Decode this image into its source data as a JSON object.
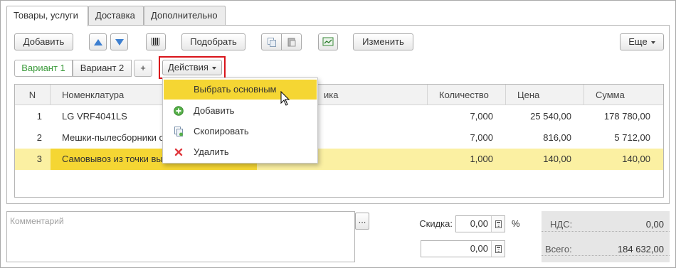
{
  "tabs": [
    {
      "label": "Товары, услуги",
      "active": true
    },
    {
      "label": "Доставка",
      "active": false
    },
    {
      "label": "Дополнительно",
      "active": false
    }
  ],
  "toolbar": {
    "add_label": "Добавить",
    "pick_label": "Подобрать",
    "edit_label": "Изменить",
    "more_label": "Еще"
  },
  "variants": {
    "items": [
      "Вариант 1",
      "Вариант 2"
    ],
    "add_label": "+",
    "actions_label": "Действия"
  },
  "table": {
    "columns": [
      "N",
      "Номенклатура",
      "ика",
      "Количество",
      "Цена",
      "Сумма"
    ],
    "rows": [
      {
        "n": "1",
        "name": "LG VRF4041LS",
        "qty": "7,000",
        "price": "25 540,00",
        "sum": "178 780,00"
      },
      {
        "n": "2",
        "name": "Мешки-пылесборники с",
        "qty": "7,000",
        "price": "816,00",
        "sum": "5 712,00"
      },
      {
        "n": "3",
        "name": "Самовывоз из точки вы",
        "qty": "1,000",
        "price": "140,00",
        "sum": "140,00"
      }
    ]
  },
  "menu": {
    "items": [
      {
        "label": "Выбрать основным",
        "icon": "none"
      },
      {
        "label": "Добавить",
        "icon": "plus-icon"
      },
      {
        "label": "Скопировать",
        "icon": "copy-icon"
      },
      {
        "label": "Удалить",
        "icon": "delete-icon"
      }
    ]
  },
  "footer": {
    "comment_placeholder": "Комментарий",
    "comment_button": "...",
    "discount_label": "Скидка:",
    "discount_value": "0,00",
    "percent_sign": "%",
    "discount_amount": "0,00",
    "vat_label": "НДС:",
    "vat_value": "0,00",
    "total_label": "Всего:",
    "total_value": "184 632,00"
  },
  "colors": {
    "selected_row": "#fbf0a2",
    "menu_highlight": "#f5d633",
    "variant_active_text": "#3a9a3a",
    "actions_outline": "#d9141b",
    "arrow_blue": "#3d7fd0"
  }
}
